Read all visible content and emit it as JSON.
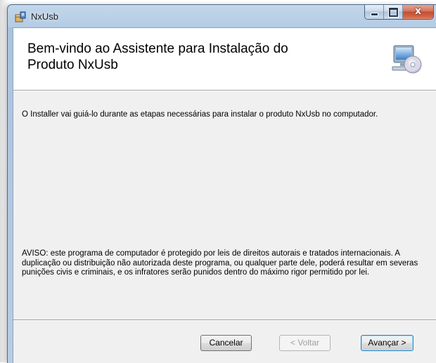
{
  "window": {
    "title": "NxUsb",
    "close_glyph": "x",
    "icons": {
      "app": "installer-box-icon",
      "banner": "computer-cd-icon"
    }
  },
  "banner": {
    "title_line1": "Bem-vindo ao Assistente para Instalação do",
    "title_line2": "Produto NxUsb"
  },
  "body": {
    "intro": "O Installer vai guiá-lo durante as etapas necessárias para instalar o produto NxUsb no computador.",
    "warning": "AVISO: este programa de computador é protegido por leis de direitos autorais e tratados internacionais. A duplicação ou distribuição não autorizada deste programa, ou qualquer parte dele, poderá resultar em severas punições civis e criminais, e os infratores serão punidos dentro do máximo rigor permitido por lei."
  },
  "buttons": {
    "cancel": "Cancelar",
    "back": "< Voltar",
    "next": "Avançar >"
  },
  "colors": {
    "titlebar": "#b3cbe4",
    "close_button": "#c14f33",
    "dialog_background": "#f0f0f0",
    "default_button_border": "#3c7fb1"
  }
}
